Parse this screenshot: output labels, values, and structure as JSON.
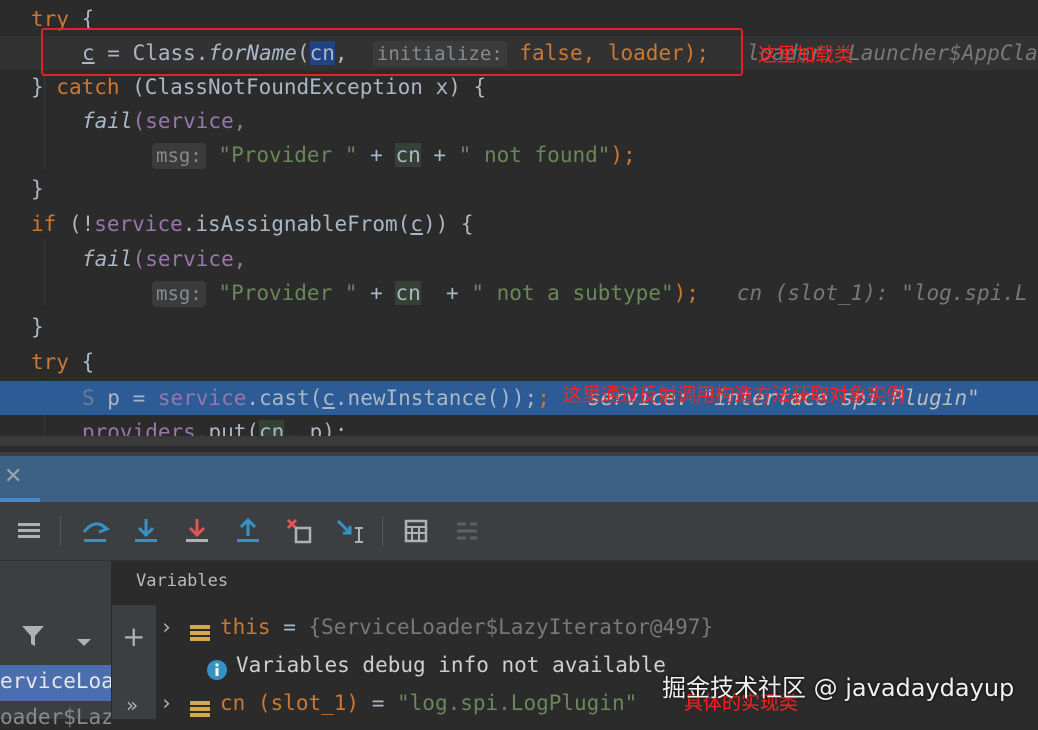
{
  "code": {
    "l1_try": "try",
    "l1_brace": " {",
    "l2_c": "c",
    "l2_assign": " = Class.",
    "l2_forName": "forName",
    "l2_paren": "(",
    "l2_cn": "cn",
    "l2_comma": ",",
    "l2_hint": "initialize:",
    "l2_false": "false",
    "l2_loader": ", loader);",
    "l2_inline": "loader: Launcher$AppCla",
    "l3_close": "} ",
    "l3_catch": "catch",
    "l3_rest": " (ClassNotFoundException x) {",
    "l4_fail": "fail",
    "l4_rest": "(service,",
    "l5_hint": "msg:",
    "l5_str1": "\"Provider \"",
    "l5_plus1": " + ",
    "l5_cn": "cn",
    "l5_plus2": " + ",
    "l5_str2": "\" not found\"",
    "l5_end": ");",
    "l6_close": "}",
    "l7_if": "if",
    "l7_rest1": " (!",
    "l7_service": "service",
    "l7_rest2": ".isAssignableFrom(",
    "l7_c": "c",
    "l7_rest3": ")) {",
    "l8_fail": "fail",
    "l8_rest": "(service,",
    "l9_hint": "msg:",
    "l9_str1": "\"Provider \"",
    "l9_plus1": " + ",
    "l9_cn": "cn",
    "l9_plus2": "  + ",
    "l9_str2": "\" not a subtype\"",
    "l9_end": ");",
    "l9_inline": "cn (slot_1): \"log.spi.L",
    "l10_close": "}",
    "l11_try": "try",
    "l11_brace": " {",
    "l12_S": "S",
    "l12_p": " p = ",
    "l12_service": "service",
    "l12_cast": ".cast(",
    "l12_c": "c",
    "l12_rest": ".newInstance());",
    "l12_inline": "service: \"interface spi.Plugin\"",
    "l13_providers": "providers",
    "l13_put": ".put(",
    "l13_cn": "cn",
    "l13_rest": ", p);"
  },
  "annotations": {
    "load_class": "这里加载类",
    "reflection": "这里通过反射调用构造方法获取对象实例",
    "impl_class": "具体的实现类"
  },
  "debug": {
    "variables_label": "Variables",
    "frame_1": "erviceLoad",
    "frame_2": "oader$Laz",
    "more": "»",
    "vars": {
      "this_name": "this",
      "this_eq": " = ",
      "this_val": "{ServiceLoader$LazyIterator@497}",
      "info_text": "Variables debug info not available",
      "cn_name": "cn (slot_1)",
      "cn_eq": " = ",
      "cn_val": "\"log.spi.LogPlugin\""
    }
  },
  "watermark": "掘金技术社区 @ javadaydayup",
  "colors": {
    "editor_bg": "#2b2b2b",
    "keyword": "#cc7832",
    "string": "#6a8759",
    "field": "#9876aa",
    "execution_line": "#2d5b95",
    "annotation_red": "#e5202a"
  }
}
